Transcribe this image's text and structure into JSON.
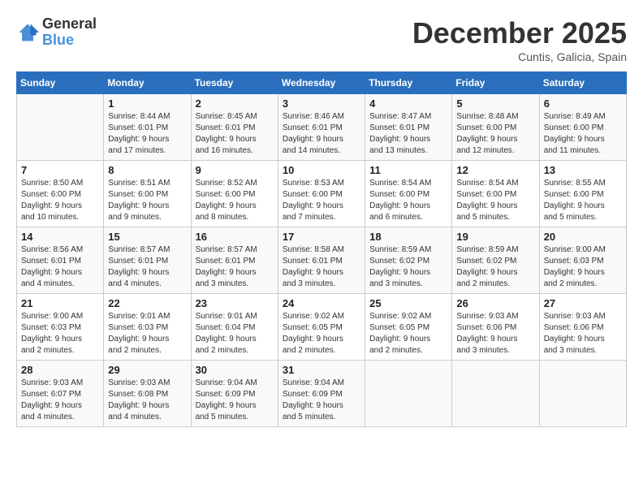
{
  "header": {
    "logo_line1": "General",
    "logo_line2": "Blue",
    "month_year": "December 2025",
    "location": "Cuntis, Galicia, Spain"
  },
  "weekdays": [
    "Sunday",
    "Monday",
    "Tuesday",
    "Wednesday",
    "Thursday",
    "Friday",
    "Saturday"
  ],
  "weeks": [
    [
      {
        "day": "",
        "info": ""
      },
      {
        "day": "1",
        "info": "Sunrise: 8:44 AM\nSunset: 6:01 PM\nDaylight: 9 hours\nand 17 minutes."
      },
      {
        "day": "2",
        "info": "Sunrise: 8:45 AM\nSunset: 6:01 PM\nDaylight: 9 hours\nand 16 minutes."
      },
      {
        "day": "3",
        "info": "Sunrise: 8:46 AM\nSunset: 6:01 PM\nDaylight: 9 hours\nand 14 minutes."
      },
      {
        "day": "4",
        "info": "Sunrise: 8:47 AM\nSunset: 6:01 PM\nDaylight: 9 hours\nand 13 minutes."
      },
      {
        "day": "5",
        "info": "Sunrise: 8:48 AM\nSunset: 6:00 PM\nDaylight: 9 hours\nand 12 minutes."
      },
      {
        "day": "6",
        "info": "Sunrise: 8:49 AM\nSunset: 6:00 PM\nDaylight: 9 hours\nand 11 minutes."
      }
    ],
    [
      {
        "day": "7",
        "info": "Sunrise: 8:50 AM\nSunset: 6:00 PM\nDaylight: 9 hours\nand 10 minutes."
      },
      {
        "day": "8",
        "info": "Sunrise: 8:51 AM\nSunset: 6:00 PM\nDaylight: 9 hours\nand 9 minutes."
      },
      {
        "day": "9",
        "info": "Sunrise: 8:52 AM\nSunset: 6:00 PM\nDaylight: 9 hours\nand 8 minutes."
      },
      {
        "day": "10",
        "info": "Sunrise: 8:53 AM\nSunset: 6:00 PM\nDaylight: 9 hours\nand 7 minutes."
      },
      {
        "day": "11",
        "info": "Sunrise: 8:54 AM\nSunset: 6:00 PM\nDaylight: 9 hours\nand 6 minutes."
      },
      {
        "day": "12",
        "info": "Sunrise: 8:54 AM\nSunset: 6:00 PM\nDaylight: 9 hours\nand 5 minutes."
      },
      {
        "day": "13",
        "info": "Sunrise: 8:55 AM\nSunset: 6:00 PM\nDaylight: 9 hours\nand 5 minutes."
      }
    ],
    [
      {
        "day": "14",
        "info": "Sunrise: 8:56 AM\nSunset: 6:01 PM\nDaylight: 9 hours\nand 4 minutes."
      },
      {
        "day": "15",
        "info": "Sunrise: 8:57 AM\nSunset: 6:01 PM\nDaylight: 9 hours\nand 4 minutes."
      },
      {
        "day": "16",
        "info": "Sunrise: 8:57 AM\nSunset: 6:01 PM\nDaylight: 9 hours\nand 3 minutes."
      },
      {
        "day": "17",
        "info": "Sunrise: 8:58 AM\nSunset: 6:01 PM\nDaylight: 9 hours\nand 3 minutes."
      },
      {
        "day": "18",
        "info": "Sunrise: 8:59 AM\nSunset: 6:02 PM\nDaylight: 9 hours\nand 3 minutes."
      },
      {
        "day": "19",
        "info": "Sunrise: 8:59 AM\nSunset: 6:02 PM\nDaylight: 9 hours\nand 2 minutes."
      },
      {
        "day": "20",
        "info": "Sunrise: 9:00 AM\nSunset: 6:03 PM\nDaylight: 9 hours\nand 2 minutes."
      }
    ],
    [
      {
        "day": "21",
        "info": "Sunrise: 9:00 AM\nSunset: 6:03 PM\nDaylight: 9 hours\nand 2 minutes."
      },
      {
        "day": "22",
        "info": "Sunrise: 9:01 AM\nSunset: 6:03 PM\nDaylight: 9 hours\nand 2 minutes."
      },
      {
        "day": "23",
        "info": "Sunrise: 9:01 AM\nSunset: 6:04 PM\nDaylight: 9 hours\nand 2 minutes."
      },
      {
        "day": "24",
        "info": "Sunrise: 9:02 AM\nSunset: 6:05 PM\nDaylight: 9 hours\nand 2 minutes."
      },
      {
        "day": "25",
        "info": "Sunrise: 9:02 AM\nSunset: 6:05 PM\nDaylight: 9 hours\nand 2 minutes."
      },
      {
        "day": "26",
        "info": "Sunrise: 9:03 AM\nSunset: 6:06 PM\nDaylight: 9 hours\nand 3 minutes."
      },
      {
        "day": "27",
        "info": "Sunrise: 9:03 AM\nSunset: 6:06 PM\nDaylight: 9 hours\nand 3 minutes."
      }
    ],
    [
      {
        "day": "28",
        "info": "Sunrise: 9:03 AM\nSunset: 6:07 PM\nDaylight: 9 hours\nand 4 minutes."
      },
      {
        "day": "29",
        "info": "Sunrise: 9:03 AM\nSunset: 6:08 PM\nDaylight: 9 hours\nand 4 minutes."
      },
      {
        "day": "30",
        "info": "Sunrise: 9:04 AM\nSunset: 6:09 PM\nDaylight: 9 hours\nand 5 minutes."
      },
      {
        "day": "31",
        "info": "Sunrise: 9:04 AM\nSunset: 6:09 PM\nDaylight: 9 hours\nand 5 minutes."
      },
      {
        "day": "",
        "info": ""
      },
      {
        "day": "",
        "info": ""
      },
      {
        "day": "",
        "info": ""
      }
    ]
  ]
}
